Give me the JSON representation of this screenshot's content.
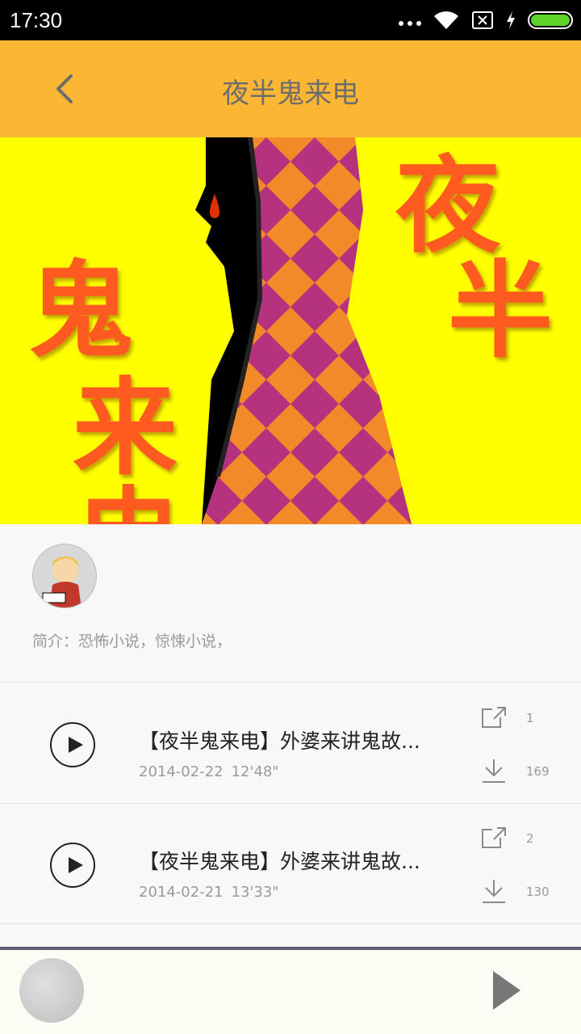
{
  "status_bar": {
    "time": "17:30",
    "battery_color": "#5fd32a"
  },
  "header": {
    "title": "夜半鬼来电",
    "background": "#fbb633",
    "back_icon": "chevron-left-icon"
  },
  "cover": {
    "characters": [
      "夜",
      "半",
      "鬼",
      "来",
      "电"
    ]
  },
  "album": {
    "intro": "简介：恐怖小说，惊悚小说，"
  },
  "tracks": [
    {
      "title": "【夜半鬼来电】外婆来讲鬼故...",
      "date": "2014-02-22",
      "duration": "12'48\"",
      "share_count": "1",
      "download_count": "169"
    },
    {
      "title": "【夜半鬼来电】外婆来讲鬼故...",
      "date": "2014-02-21",
      "duration": "13'33\"",
      "share_count": "2",
      "download_count": "130"
    }
  ],
  "player": {
    "play_icon": "play-icon"
  }
}
